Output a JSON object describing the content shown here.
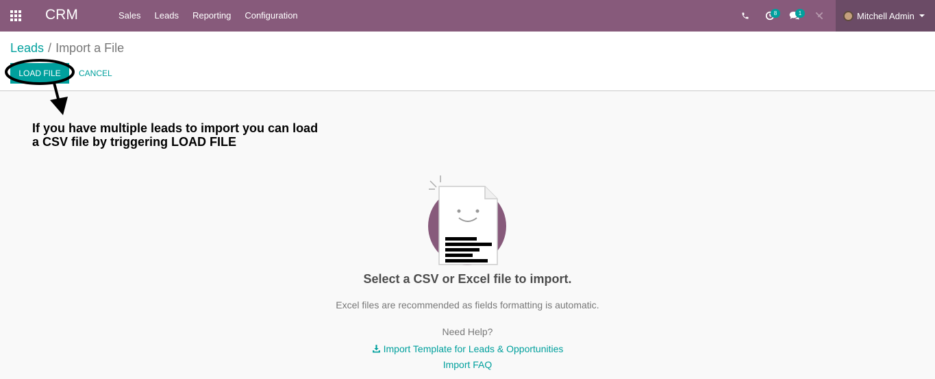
{
  "navbar": {
    "brand": "CRM",
    "menu": [
      "Sales",
      "Leads",
      "Reporting",
      "Configuration"
    ],
    "activity_count": "8",
    "message_count": "1",
    "user_name": "Mitchell Admin",
    "color": "#875a7b"
  },
  "control_panel": {
    "breadcrumb_parent": "Leads",
    "breadcrumb_separator": "/",
    "breadcrumb_current": "Import a File",
    "load_button": "LOAD FILE",
    "cancel_button": "CANCEL"
  },
  "annotation": {
    "text": "If you have multiple leads to import you can load\na CSV file by triggering LOAD FILE"
  },
  "main": {
    "title": "Select a CSV or Excel file to import.",
    "subtitle": "Excel files are recommended as fields formatting is automatic.",
    "help_label": "Need Help?",
    "template_link": "Import Template for Leads & Opportunities",
    "faq_link": "Import FAQ"
  },
  "colors": {
    "accent": "#00a09d",
    "navbar": "#875a7b",
    "illustration_circle": "#875a7b"
  }
}
